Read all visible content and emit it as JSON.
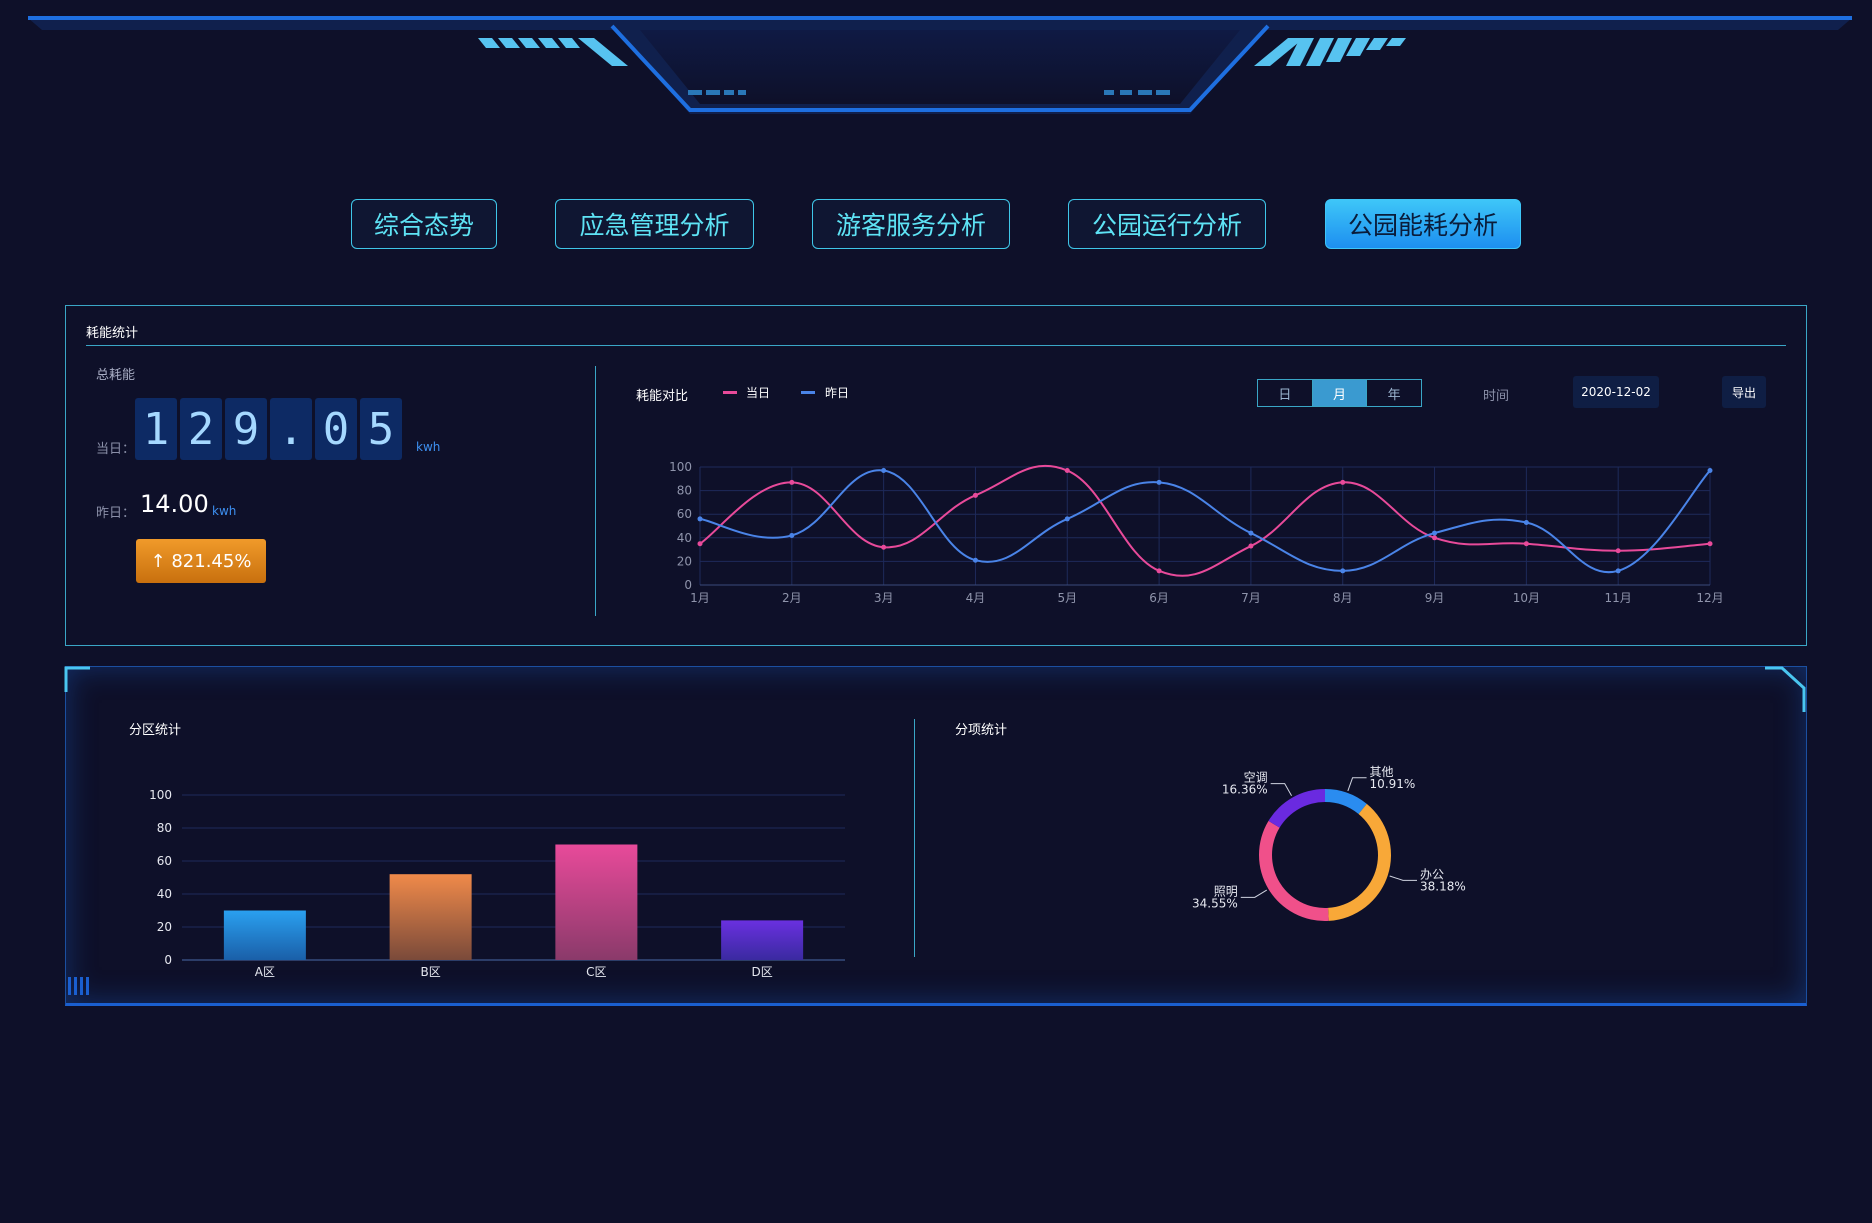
{
  "nav": {
    "tabs": [
      {
        "label": "综合态势"
      },
      {
        "label": "应急管理分析"
      },
      {
        "label": "游客服务分析"
      },
      {
        "label": "公园运行分析"
      },
      {
        "label": "公园能耗分析"
      }
    ],
    "active_index": 4
  },
  "energy_panel": {
    "title": "耗能统计",
    "total_label": "总耗能",
    "today_label": "当日：",
    "today_digits": [
      "1",
      "2",
      "9",
      ".",
      "0",
      "5"
    ],
    "today_unit": "kwh",
    "yesterday_label": "昨日：",
    "yesterday_value": "14.00",
    "yesterday_unit": "kwh",
    "change_badge": "↑ 821.45%",
    "compare_title": "耗能对比",
    "legend_today": "当日",
    "legend_yesterday": "昨日",
    "period_buttons": [
      "日",
      "月",
      "年"
    ],
    "period_selected": "月",
    "time_label": "时间",
    "date_value": "2020-12-02",
    "export_label": "导出"
  },
  "zone_panel": {
    "title": "分区统计"
  },
  "item_panel": {
    "title": "分项统计"
  },
  "colors": {
    "background": "#0e1029",
    "accent": "#3fc6e8",
    "today_series": "#e84a9a",
    "yesterday_series": "#4a84e8",
    "badge": "#e5891c"
  },
  "chart_data": [
    {
      "type": "line",
      "title": "耗能对比",
      "categories": [
        "1月",
        "2月",
        "3月",
        "4月",
        "5月",
        "6月",
        "7月",
        "8月",
        "9月",
        "10月",
        "11月",
        "12月"
      ],
      "series": [
        {
          "name": "当日",
          "color": "#e84a9a",
          "values": [
            35,
            87,
            32,
            76,
            97,
            12,
            33,
            87,
            40,
            35,
            29,
            35
          ]
        },
        {
          "name": "昨日",
          "color": "#4a84e8",
          "values": [
            56,
            42,
            97,
            21,
            56,
            87,
            44,
            12,
            44,
            53,
            12,
            97
          ]
        }
      ],
      "ylim": [
        0,
        100
      ],
      "yticks": [
        0,
        20,
        40,
        60,
        80,
        100
      ],
      "grid": true
    },
    {
      "type": "bar",
      "title": "分区统计",
      "categories": [
        "A区",
        "B区",
        "C区",
        "D区"
      ],
      "values": [
        30,
        52,
        70,
        24
      ],
      "colors": [
        [
          "#2aa0f0",
          "#1a5fa8"
        ],
        [
          "#f08a4a",
          "#7a4a3a"
        ],
        [
          "#e84a9a",
          "#8a3a6a"
        ],
        [
          "#6a30e0",
          "#3a2aa0"
        ]
      ],
      "ylim": [
        0,
        100
      ],
      "yticks": [
        0,
        20,
        40,
        60,
        80,
        100
      ],
      "grid": true
    },
    {
      "type": "pie",
      "title": "分项统计",
      "slices": [
        {
          "label": "其他",
          "value": 10.91,
          "pct": "10.91%",
          "color": "#2a8cf0"
        },
        {
          "label": "办公",
          "value": 38.18,
          "pct": "38.18%",
          "color": "#f8a838"
        },
        {
          "label": "照明",
          "value": 34.55,
          "pct": "34.55%",
          "color": "#f0508a"
        },
        {
          "label": "空调",
          "value": 16.36,
          "pct": "16.36%",
          "color": "#6a2ae0"
        }
      ]
    }
  ]
}
